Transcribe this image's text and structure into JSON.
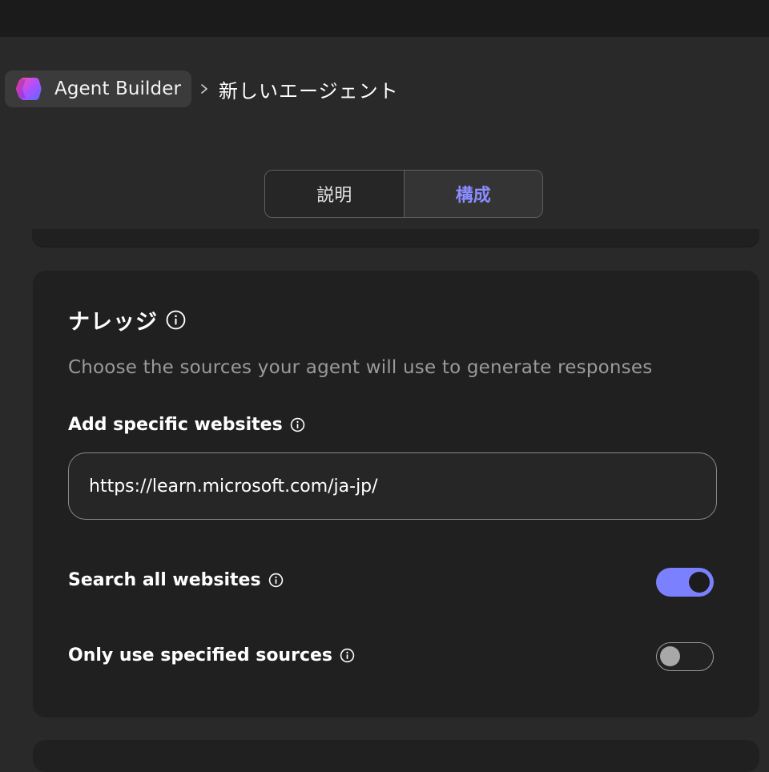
{
  "breadcrumb": {
    "app_label": "Agent Builder",
    "page_label": "新しいエージェント"
  },
  "tabs": [
    {
      "label": "説明",
      "selected": false
    },
    {
      "label": "構成",
      "selected": true
    }
  ],
  "knowledge": {
    "title": "ナレッジ",
    "description": "Choose the sources your agent will use to generate responses",
    "websites_label": "Add specific websites",
    "website_url": "https://learn.microsoft.com/ja-jp/",
    "search_all_label": "Search all websites",
    "search_all_on": true,
    "only_specified_label": "Only use specified sources",
    "only_specified_on": false
  },
  "colors": {
    "accent": "#7b80ff",
    "tab_selected_text": "#8a8cff",
    "background": "#292929",
    "card": "#202020"
  },
  "icons": {
    "app_logo": "agent-builder-logo-icon",
    "separator": "chevron-right-icon",
    "info": "info-icon"
  }
}
